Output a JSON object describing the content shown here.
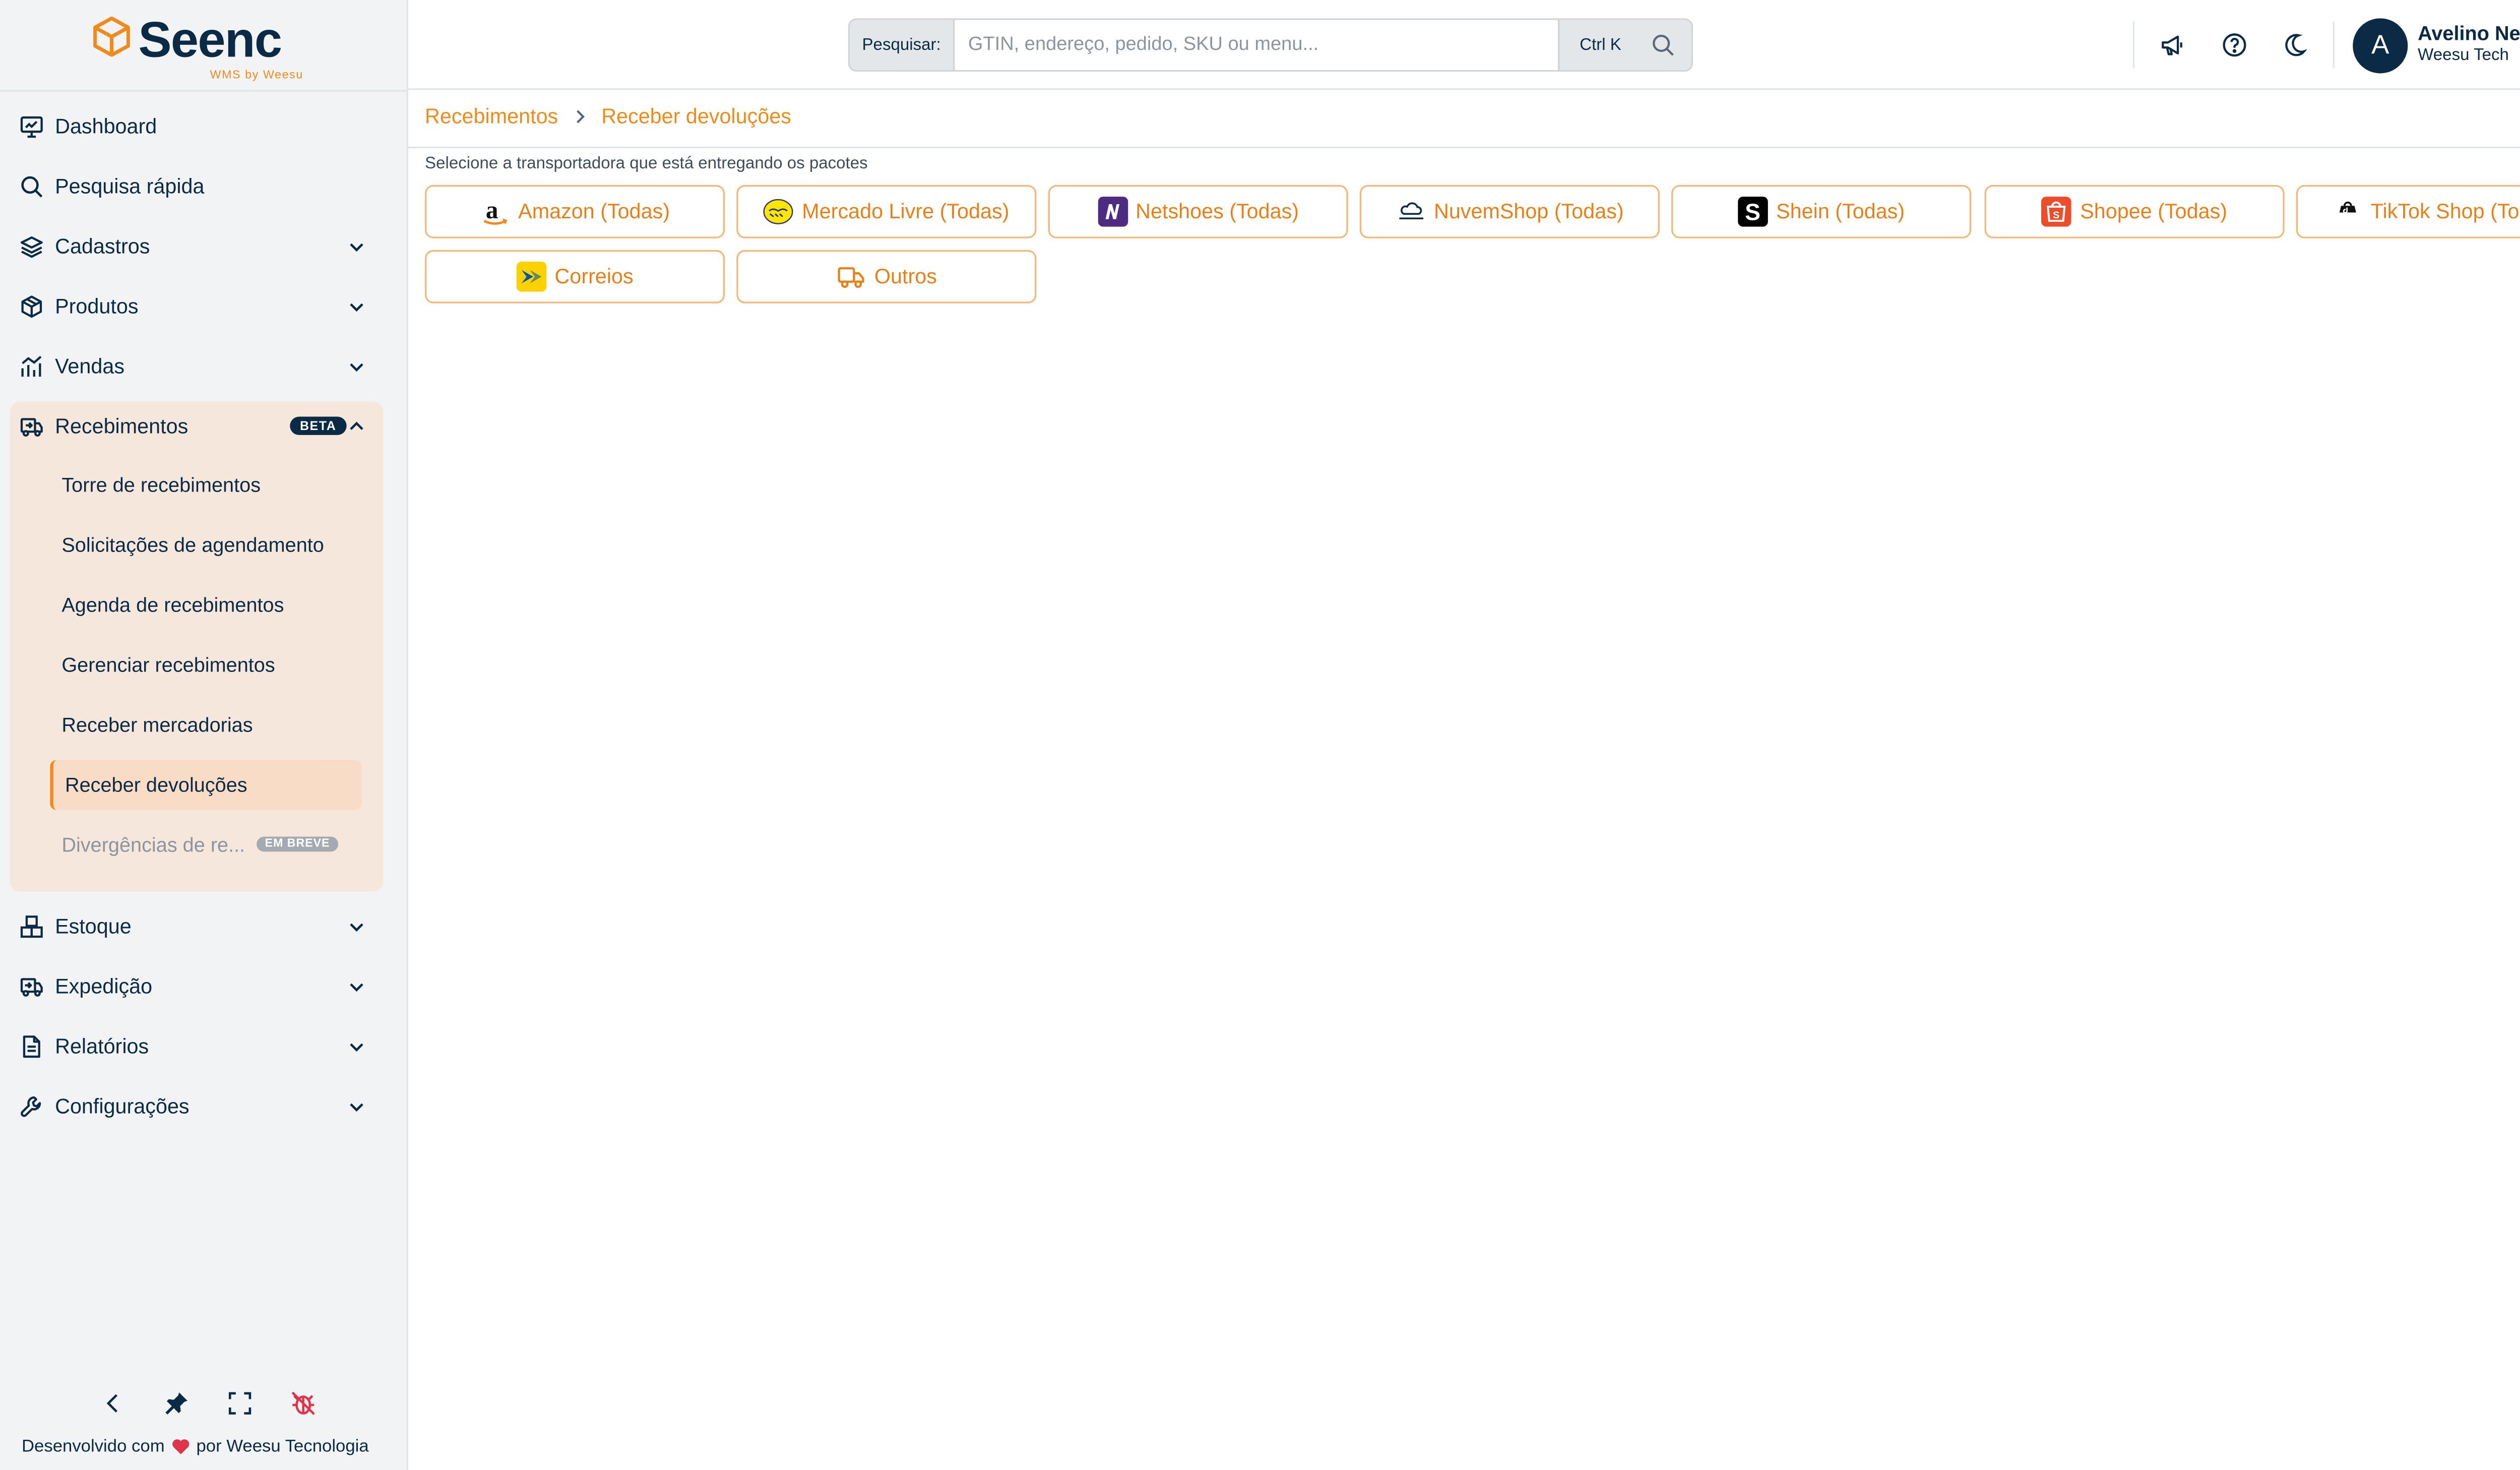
{
  "brand": {
    "name": "Seenc",
    "tagline": "WMS by Weesu"
  },
  "search": {
    "label": "Pesquisar:",
    "placeholder": "GTIN, endereço, pedido, SKU ou menu...",
    "shortcut": "Ctrl K"
  },
  "user": {
    "initial": "A",
    "name": "Avelino Neto",
    "org": "Weesu Tech"
  },
  "nav": {
    "dashboard": "Dashboard",
    "quick_search": "Pesquisa rápida",
    "cadastros": "Cadastros",
    "produtos": "Produtos",
    "vendas": "Vendas",
    "recebimentos": "Recebimentos",
    "recebimentos_badge": "BETA",
    "sub": [
      "Torre de recebimentos",
      "Solicitações de agendamento",
      "Agenda de recebimentos",
      "Gerenciar recebimentos",
      "Receber mercadorias",
      "Receber devoluções",
      "Divergências de re..."
    ],
    "soon_badge": "EM BREVE",
    "estoque": "Estoque",
    "expedicao": "Expedição",
    "relatorios": "Relatórios",
    "configuracoes": "Configurações"
  },
  "footer": {
    "left": "Desenvolvido com",
    "right": "por Weesu Tecnologia"
  },
  "breadcrumb": {
    "parent": "Recebimentos",
    "current": "Receber devoluções"
  },
  "hint": "Selecione a transportadora que está entregando os pacotes",
  "carriers": [
    {
      "label": "Amazon (Todas)",
      "icon": "amazon-logo"
    },
    {
      "label": "Mercado Livre (Todas)",
      "icon": "mercado-livre-logo"
    },
    {
      "label": "Netshoes (Todas)",
      "icon": "netshoes-logo"
    },
    {
      "label": "NuvemShop (Todas)",
      "icon": "nuvemshop-logo"
    },
    {
      "label": "Shein (Todas)",
      "icon": "shein-logo"
    },
    {
      "label": "Shopee (Todas)",
      "icon": "shopee-logo"
    },
    {
      "label": "TikTok Shop (Todas)",
      "icon": "tiktok-shop-logo"
    },
    {
      "label": "Correios",
      "icon": "correios-logo"
    },
    {
      "label": "Outros",
      "icon": "truck-icon"
    }
  ],
  "colors": {
    "accent": "#f08a1c",
    "navy": "#0b2a45",
    "active_bg": "#f6e7dc"
  }
}
